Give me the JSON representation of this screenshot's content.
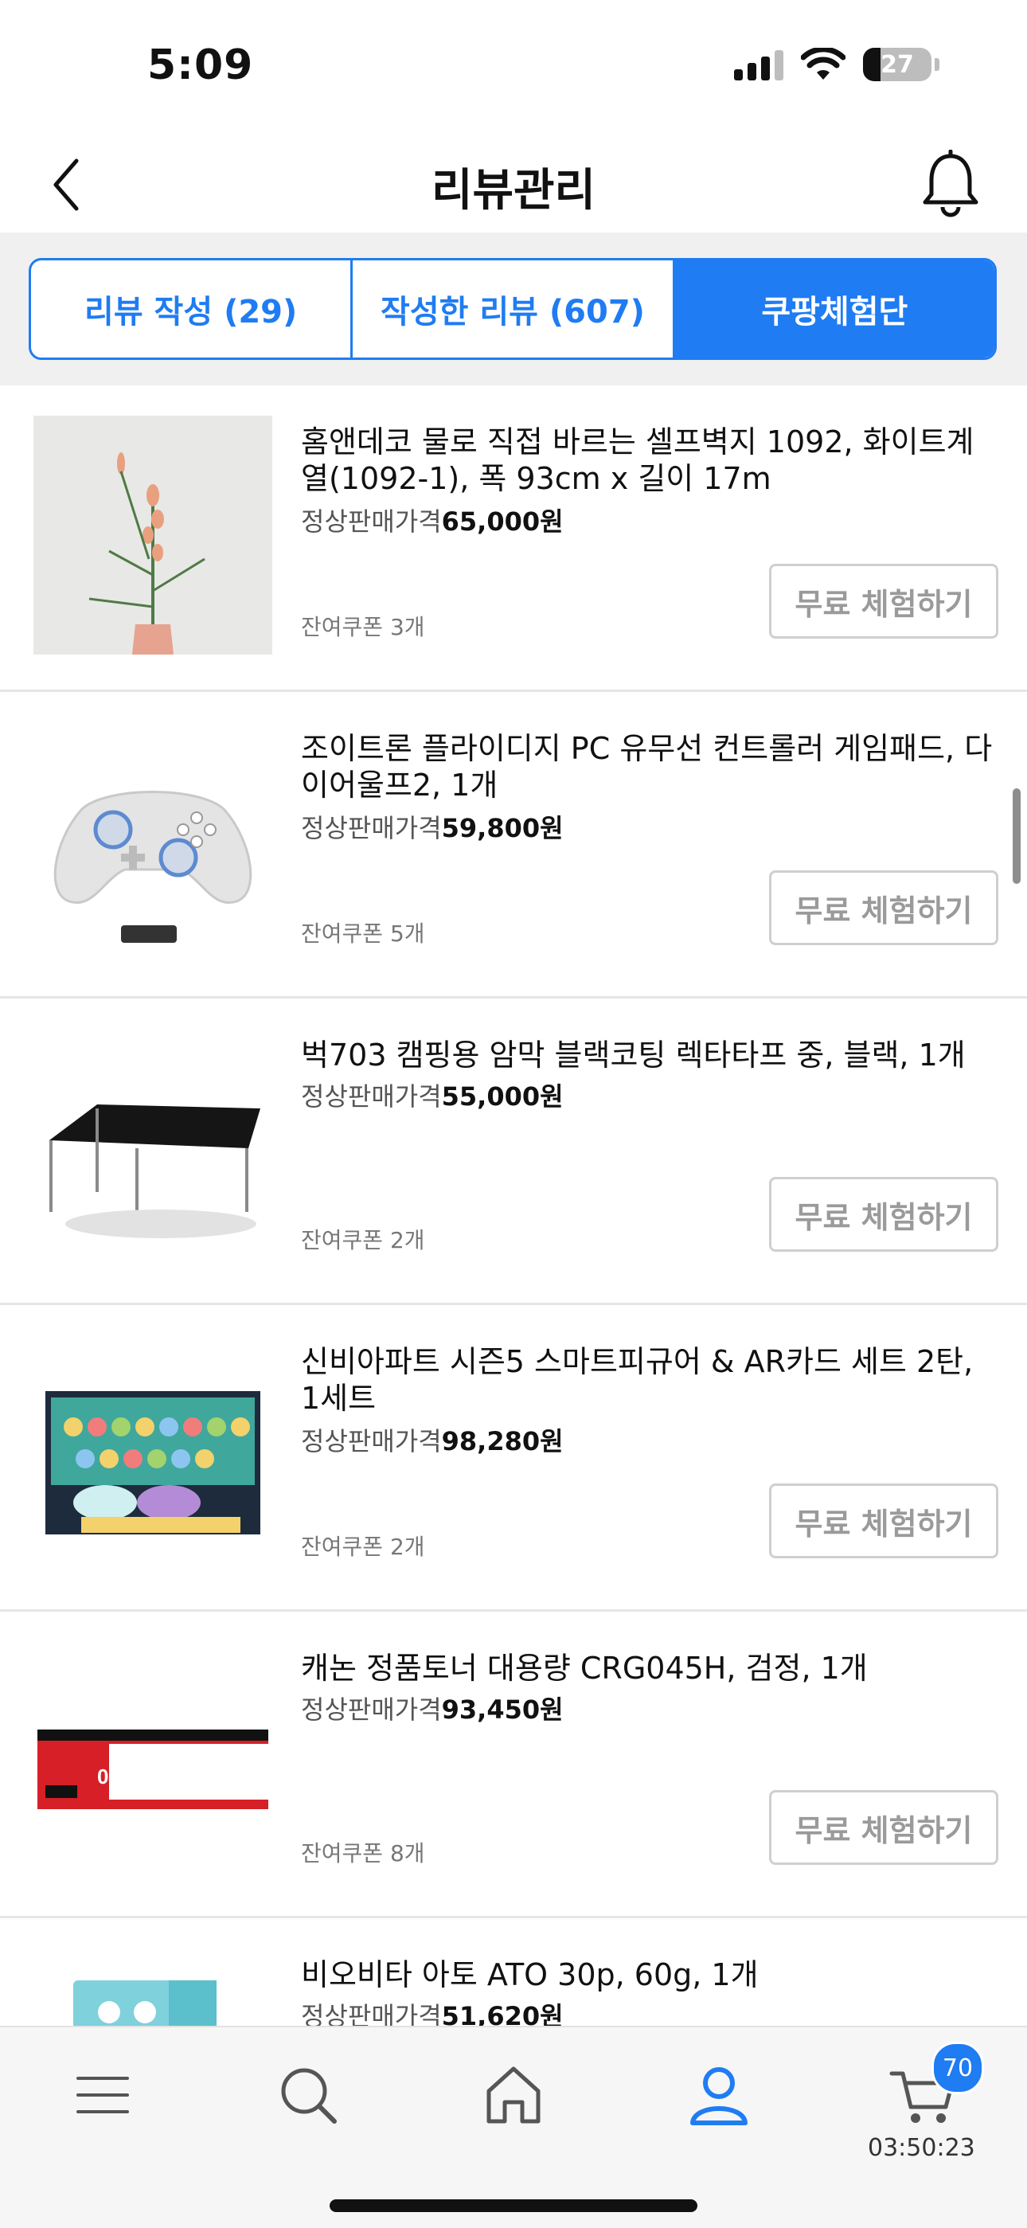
{
  "status_bar": {
    "time": "5:09",
    "battery": "27"
  },
  "header": {
    "title": "리뷰관리"
  },
  "tabs": [
    {
      "label": "리뷰 작성 (29)"
    },
    {
      "label": "작성한 리뷰 (607)"
    },
    {
      "label": "쿠팡체험단"
    }
  ],
  "items": [
    {
      "title": "홈앤데코 물로 직접 바르는 셀프벽지 1092, 화이트계열(1092-1), 폭 93cm x 길이 17m",
      "price_label": "정상판매가격",
      "price": "65,000원",
      "coupon": "잔여쿠폰 3개",
      "button": "무료 체험하기"
    },
    {
      "title": "조이트론 플라이디지 PC 유무선 컨트롤러 게임패드, 다이어울프2, 1개",
      "price_label": "정상판매가격",
      "price": "59,800원",
      "coupon": "잔여쿠폰 5개",
      "button": "무료 체험하기"
    },
    {
      "title": "벅703 캠핑용 암막 블랙코팅 렉타타프 중, 블랙, 1개",
      "price_label": "정상판매가격",
      "price": "55,000원",
      "coupon": "잔여쿠폰 2개",
      "button": "무료 체험하기"
    },
    {
      "title": "신비아파트 시즌5 스마트피규어 & AR카드 세트 2탄, 1세트",
      "price_label": "정상판매가격",
      "price": "98,280원",
      "coupon": "잔여쿠폰 2개",
      "button": "무료 체험하기"
    },
    {
      "title": "캐논 정품토너 대용량 CRG045H, 검정, 1개",
      "price_label": "정상판매가격",
      "price": "93,450원",
      "coupon": "잔여쿠폰 8개",
      "button": "무료 체험하기"
    },
    {
      "title": "비오비타 아토 ATO 30p, 60g, 1개",
      "price_label": "정상판매가격",
      "price": "51,620원",
      "coupon": "",
      "button": ""
    }
  ],
  "bottom_nav": {
    "items": [
      "menu-icon",
      "search-icon",
      "home-icon",
      "my-account-icon",
      "cart-icon"
    ],
    "cart_badge": "70",
    "cart_timer": "03:50:23"
  },
  "colors": {
    "accent": "#1f7cf2",
    "button_border": "#cfcfcf",
    "tab_bg": "#f0f0f0"
  }
}
